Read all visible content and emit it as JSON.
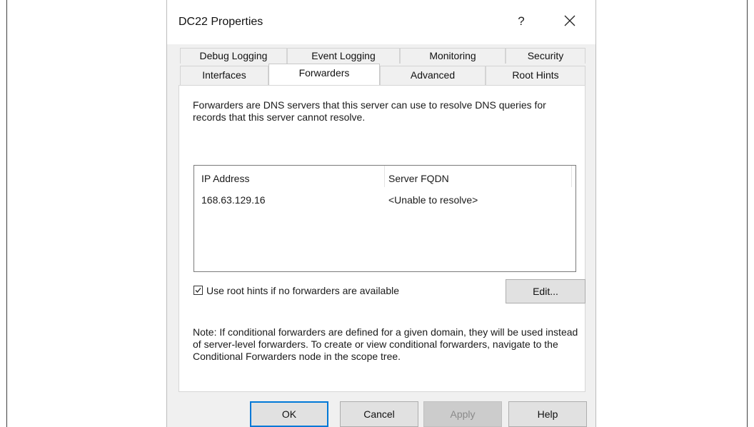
{
  "dialog": {
    "title": "DC22 Properties",
    "help_glyph": "?",
    "close_icon": "close-icon"
  },
  "tabs": {
    "back_row": [
      "Debug Logging",
      "Event Logging",
      "Monitoring",
      "Security"
    ],
    "front_row": [
      "Interfaces",
      "Forwarders",
      "Advanced",
      "Root Hints"
    ],
    "active": "Forwarders"
  },
  "forwarders": {
    "description": "Forwarders are DNS servers that this server can use to resolve DNS queries for records that this server cannot resolve.",
    "columns": [
      "IP Address",
      "Server FQDN"
    ],
    "rows": [
      {
        "ip": "168.63.129.16",
        "fqdn": "<Unable to resolve>"
      }
    ],
    "use_root_hints": {
      "checked": true,
      "label": "Use root hints if no forwarders are available"
    },
    "edit_label": "Edit...",
    "note": "Note: If conditional forwarders are defined for a given domain, they will be used instead of server-level forwarders.  To create or view conditional forwarders, navigate to the Conditional Forwarders node in the scope tree."
  },
  "footer": {
    "ok": "OK",
    "cancel": "Cancel",
    "apply": "Apply",
    "help": "Help"
  },
  "colors": {
    "accent": "#0078d7",
    "dialog_bg": "#f0f0f0",
    "panel_bg": "#ffffff"
  }
}
